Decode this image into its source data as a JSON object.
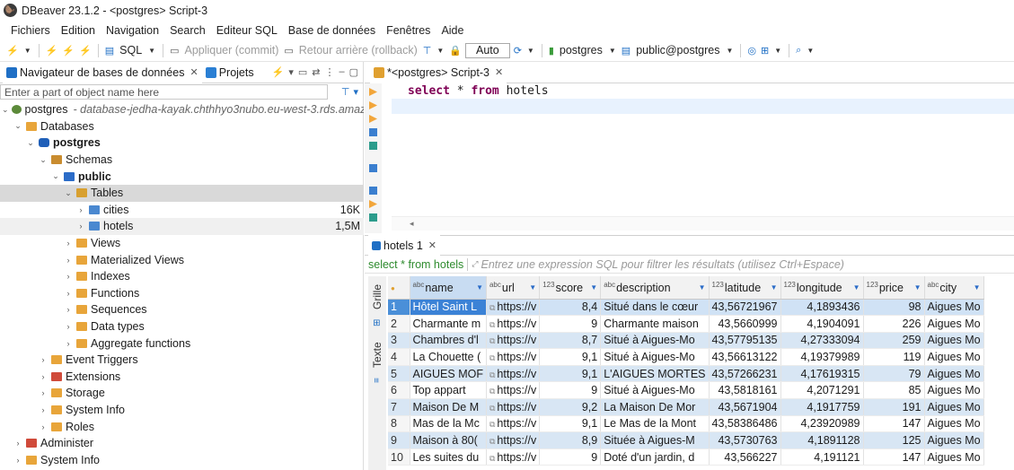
{
  "window": {
    "title": "DBeaver 23.1.2 - <postgres> Script-3"
  },
  "menu": [
    "Fichiers",
    "Edition",
    "Navigation",
    "Search",
    "Editeur SQL",
    "Base de données",
    "Fenêtres",
    "Aide"
  ],
  "toolbar": {
    "sql": "SQL",
    "commit": "Appliquer (commit)",
    "rollback": "Retour arrière (rollback)",
    "mode": "Auto",
    "connection": "postgres",
    "schema": "public@postgres"
  },
  "left": {
    "tab_nav": "Navigateur de bases de données",
    "tab_projects": "Projets",
    "filter_placeholder": "Enter a part of object name here",
    "tree": [
      {
        "label": "postgres",
        "desc": "- database-jedha-kayak.chthhyo3nubo.eu-west-3.rds.amazon"
      },
      {
        "label": "Databases"
      },
      {
        "label": "postgres"
      },
      {
        "label": "Schemas"
      },
      {
        "label": "public"
      },
      {
        "label": "Tables"
      },
      {
        "label": "cities",
        "size": "16K"
      },
      {
        "label": "hotels",
        "size": "1,5M"
      },
      {
        "label": "Views"
      },
      {
        "label": "Materialized Views"
      },
      {
        "label": "Indexes"
      },
      {
        "label": "Functions"
      },
      {
        "label": "Sequences"
      },
      {
        "label": "Data types"
      },
      {
        "label": "Aggregate functions"
      },
      {
        "label": "Event Triggers"
      },
      {
        "label": "Extensions"
      },
      {
        "label": "Storage"
      },
      {
        "label": "System Info"
      },
      {
        "label": "Roles"
      },
      {
        "label": "Administer"
      },
      {
        "label": "System Info"
      }
    ]
  },
  "editor": {
    "tab": "*<postgres> Script-3",
    "kw_select": "select",
    "star": "*",
    "kw_from": "from",
    "table": "hotels"
  },
  "results": {
    "tab": "hotels 1",
    "query": "select * from hotels",
    "filter_placeholder": "Entrez une expression SQL pour filtrer les résultats (utilisez Ctrl+Espace)",
    "side_grid": "Grille",
    "side_text": "Texte",
    "columns": [
      {
        "type": "abc",
        "name": "name"
      },
      {
        "type": "abc",
        "name": "url"
      },
      {
        "type": "123",
        "name": "score"
      },
      {
        "type": "abc",
        "name": "description"
      },
      {
        "type": "123",
        "name": "latitude"
      },
      {
        "type": "123",
        "name": "longitude"
      },
      {
        "type": "123",
        "name": "price"
      },
      {
        "type": "abc",
        "name": "city"
      }
    ],
    "rows": [
      [
        "1",
        "Hôtel Saint L",
        "https://v",
        "8,4",
        "Situé dans le cœur",
        "43,56721967",
        "4,1893436",
        "98",
        "Aigues Mo"
      ],
      [
        "2",
        "Charmante m",
        "https://v",
        "9",
        "Charmante maison",
        "43,5660999",
        "4,1904091",
        "226",
        "Aigues Mo"
      ],
      [
        "3",
        "Chambres d'l",
        "https://v",
        "8,7",
        "Situé à Aigues-Mo",
        "43,57795135",
        "4,27333094",
        "259",
        "Aigues Mo"
      ],
      [
        "4",
        "La Chouette (",
        "https://v",
        "9,1",
        "Situé à Aigues-Mo",
        "43,56613122",
        "4,19379989",
        "119",
        "Aigues Mo"
      ],
      [
        "5",
        "AIGUES MOF",
        "https://v",
        "9,1",
        "L'AIGUES MORTES",
        "43,57266231",
        "4,17619315",
        "79",
        "Aigues Mo"
      ],
      [
        "6",
        "Top appart",
        "https://v",
        "9",
        "Situé à Aigues-Mo",
        "43,5818161",
        "4,2071291",
        "85",
        "Aigues Mo"
      ],
      [
        "7",
        "Maison De M",
        "https://v",
        "9,2",
        "La Maison De Mor",
        "43,5671904",
        "4,1917759",
        "191",
        "Aigues Mo"
      ],
      [
        "8",
        "Mas de la Mc",
        "https://v",
        "9,1",
        "Le Mas de la Mont",
        "43,58386486",
        "4,23920989",
        "147",
        "Aigues Mo"
      ],
      [
        "9",
        "Maison à 80(",
        "https://v",
        "8,9",
        "Située à Aigues-M",
        "43,5730763",
        "4,1891128",
        "125",
        "Aigues Mo"
      ],
      [
        "10",
        "Les suites du",
        "https://v",
        "9",
        "Doté d'un jardin, d",
        "43,566227",
        "4,191121",
        "147",
        "Aigues Mo"
      ]
    ]
  }
}
